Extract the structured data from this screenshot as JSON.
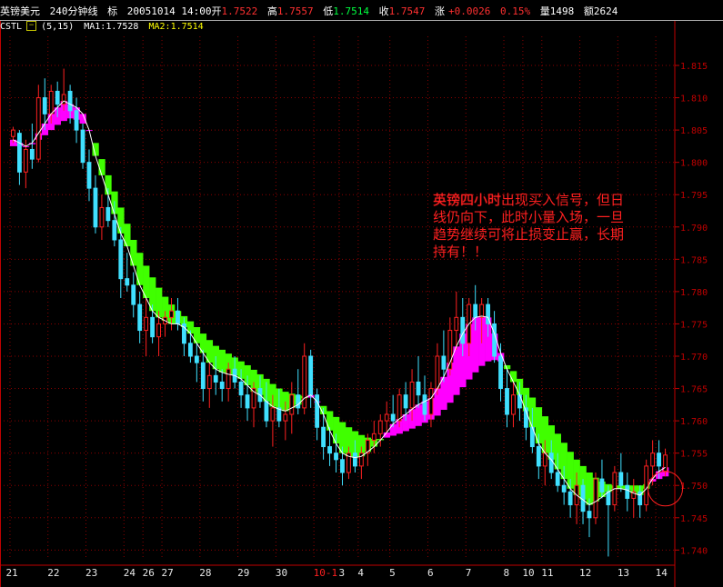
{
  "header": {
    "symbol": "英镑美元",
    "period": "240分钟线",
    "mark": "标",
    "datetime": "20051014 14:00",
    "open_label": "开",
    "open": "1.7522",
    "high_label": "高",
    "high": "1.7557",
    "low_label": "低",
    "low": "1.7514",
    "close_label": "收",
    "close": "1.7547",
    "change_label": "涨",
    "change": "+0.0026",
    "change_pct": "0.15%",
    "volume_label": "量",
    "volume": "1498",
    "amount_label": "额",
    "amount": "2624"
  },
  "indicator": {
    "name": "CSTL",
    "toggle": "−",
    "params": "(5,15)",
    "ma1": "MA1:1.7528",
    "ma2": "MA2:1.7514"
  },
  "annotation": {
    "lead": "英镑四小时",
    "rest": "出现买入信号，但日线仍向下，此时小量入场，一旦趋势继续可将止损变止赢，长期持有！！"
  },
  "colors": {
    "bull": "#ff2020",
    "bear": "#40e0ff",
    "fill_up": "#ff00ff",
    "fill_down": "#40ff00",
    "ma_line": "#ffffff",
    "grid": "#8b0000",
    "axis": "#c00000"
  },
  "chart_data": {
    "type": "candlestick",
    "title": "",
    "ylim": [
      1.7385,
      1.8195
    ],
    "y_ticks": [
      "1.815",
      "1.810",
      "1.805",
      "1.800",
      "1.795",
      "1.790",
      "1.785",
      "1.780",
      "1.775",
      "1.770",
      "1.765",
      "1.760",
      "1.755",
      "1.750",
      "1.745",
      "1.740"
    ],
    "x_labels": [
      {
        "label": "21",
        "i": 0
      },
      {
        "label": "22",
        "i": 6
      },
      {
        "label": "23",
        "i": 12
      },
      {
        "label": "24",
        "i": 18
      },
      {
        "label": "26",
        "i": 21
      },
      {
        "label": "27",
        "i": 24
      },
      {
        "label": "28",
        "i": 30
      },
      {
        "label": "29",
        "i": 36
      },
      {
        "label": "30",
        "i": 42
      },
      {
        "label": "10-1",
        "i": 48
      },
      {
        "label": "3",
        "i": 52
      },
      {
        "label": "4",
        "i": 55
      },
      {
        "label": "5",
        "i": 60
      },
      {
        "label": "6",
        "i": 66
      },
      {
        "label": "7",
        "i": 72
      },
      {
        "label": "8",
        "i": 78
      },
      {
        "label": "10",
        "i": 81
      },
      {
        "label": "11",
        "i": 84
      },
      {
        "label": "12",
        "i": 90
      },
      {
        "label": "13",
        "i": 96
      },
      {
        "label": "14",
        "i": 102
      }
    ],
    "candles": [
      [
        1.804,
        1.8055,
        1.803,
        1.805
      ],
      [
        1.8045,
        1.805,
        1.7965,
        1.7985
      ],
      [
        1.7985,
        1.8035,
        1.796,
        1.802
      ],
      [
        1.802,
        1.806,
        1.799,
        1.8005
      ],
      [
        1.8005,
        1.812,
        1.8,
        1.81
      ],
      [
        1.81,
        1.813,
        1.805,
        1.8075
      ],
      [
        1.8075,
        1.812,
        1.806,
        1.811
      ],
      [
        1.811,
        1.8125,
        1.807,
        1.809
      ],
      [
        1.809,
        1.8145,
        1.808,
        1.8105
      ],
      [
        1.811,
        1.812,
        1.806,
        1.808
      ],
      [
        1.808,
        1.81,
        1.803,
        1.805
      ],
      [
        1.805,
        1.806,
        1.799,
        1.8
      ],
      [
        1.8,
        1.802,
        1.794,
        1.796
      ],
      [
        1.796,
        1.798,
        1.789,
        1.79
      ],
      [
        1.79,
        1.795,
        1.788,
        1.793
      ],
      [
        1.793,
        1.796,
        1.79,
        1.791
      ],
      [
        1.791,
        1.794,
        1.787,
        1.788
      ],
      [
        1.788,
        1.79,
        1.779,
        1.782
      ],
      [
        1.782,
        1.786,
        1.78,
        1.781
      ],
      [
        1.781,
        1.783,
        1.776,
        1.778
      ],
      [
        1.778,
        1.78,
        1.772,
        1.774
      ],
      [
        1.774,
        1.779,
        1.77,
        1.776
      ],
      [
        1.776,
        1.778,
        1.772,
        1.773
      ],
      [
        1.773,
        1.777,
        1.77,
        1.775
      ],
      [
        1.775,
        1.777,
        1.773,
        1.776
      ],
      [
        1.776,
        1.779,
        1.774,
        1.777
      ],
      [
        1.777,
        1.779,
        1.774,
        1.775
      ],
      [
        1.775,
        1.776,
        1.77,
        1.772
      ],
      [
        1.772,
        1.774,
        1.769,
        1.77
      ],
      [
        1.77,
        1.772,
        1.766,
        1.769
      ],
      [
        1.769,
        1.771,
        1.763,
        1.765
      ],
      [
        1.765,
        1.769,
        1.762,
        1.767
      ],
      [
        1.767,
        1.77,
        1.764,
        1.766
      ],
      [
        1.766,
        1.768,
        1.763,
        1.765
      ],
      [
        1.765,
        1.769,
        1.763,
        1.768
      ],
      [
        1.768,
        1.77,
        1.765,
        1.766
      ],
      [
        1.766,
        1.768,
        1.762,
        1.764
      ],
      [
        1.764,
        1.767,
        1.76,
        1.762
      ],
      [
        1.762,
        1.766,
        1.759,
        1.765
      ],
      [
        1.765,
        1.767,
        1.762,
        1.763
      ],
      [
        1.763,
        1.766,
        1.759,
        1.76
      ],
      [
        1.76,
        1.764,
        1.756,
        1.762
      ],
      [
        1.762,
        1.765,
        1.759,
        1.76
      ],
      [
        1.76,
        1.763,
        1.757,
        1.761
      ],
      [
        1.761,
        1.766,
        1.758,
        1.764
      ],
      [
        1.764,
        1.768,
        1.761,
        1.762
      ],
      [
        1.762,
        1.772,
        1.761,
        1.77
      ],
      [
        1.77,
        1.771,
        1.762,
        1.764
      ],
      [
        1.764,
        1.765,
        1.757,
        1.759
      ],
      [
        1.759,
        1.762,
        1.754,
        1.756
      ],
      [
        1.756,
        1.759,
        1.753,
        1.755
      ],
      [
        1.755,
        1.758,
        1.752,
        1.754
      ],
      [
        1.754,
        1.756,
        1.75,
        1.752
      ],
      [
        1.752,
        1.756,
        1.751,
        1.755
      ],
      [
        1.755,
        1.757,
        1.752,
        1.753
      ],
      [
        1.753,
        1.756,
        1.751,
        1.755
      ],
      [
        1.755,
        1.758,
        1.753,
        1.757
      ],
      [
        1.757,
        1.76,
        1.755,
        1.758
      ],
      [
        1.758,
        1.761,
        1.756,
        1.76
      ],
      [
        1.76,
        1.763,
        1.758,
        1.761
      ],
      [
        1.761,
        1.764,
        1.759,
        1.76
      ],
      [
        1.76,
        1.765,
        1.759,
        1.764
      ],
      [
        1.764,
        1.766,
        1.76,
        1.762
      ],
      [
        1.762,
        1.768,
        1.76,
        1.766
      ],
      [
        1.766,
        1.77,
        1.762,
        1.764
      ],
      [
        1.764,
        1.767,
        1.76,
        1.761
      ],
      [
        1.761,
        1.766,
        1.759,
        1.765
      ],
      [
        1.765,
        1.772,
        1.764,
        1.77
      ],
      [
        1.77,
        1.774,
        1.766,
        1.768
      ],
      [
        1.768,
        1.776,
        1.767,
        1.774
      ],
      [
        1.774,
        1.78,
        1.771,
        1.776
      ],
      [
        1.776,
        1.779,
        1.77,
        1.772
      ],
      [
        1.772,
        1.779,
        1.77,
        1.778
      ],
      [
        1.778,
        1.781,
        1.774,
        1.776
      ],
      [
        1.776,
        1.779,
        1.772,
        1.778
      ],
      [
        1.778,
        1.779,
        1.773,
        1.775
      ],
      [
        1.775,
        1.777,
        1.769,
        1.77
      ],
      [
        1.77,
        1.772,
        1.763,
        1.765
      ],
      [
        1.765,
        1.768,
        1.759,
        1.761
      ],
      [
        1.761,
        1.766,
        1.759,
        1.764
      ],
      [
        1.764,
        1.766,
        1.76,
        1.762
      ],
      [
        1.762,
        1.764,
        1.757,
        1.759
      ],
      [
        1.759,
        1.762,
        1.755,
        1.756
      ],
      [
        1.756,
        1.758,
        1.751,
        1.753
      ],
      [
        1.753,
        1.757,
        1.75,
        1.755
      ],
      [
        1.755,
        1.757,
        1.751,
        1.752
      ],
      [
        1.752,
        1.755,
        1.749,
        1.75
      ],
      [
        1.75,
        1.753,
        1.747,
        1.749
      ],
      [
        1.749,
        1.751,
        1.745,
        1.747
      ],
      [
        1.747,
        1.752,
        1.744,
        1.75
      ],
      [
        1.75,
        1.751,
        1.744,
        1.746
      ],
      [
        1.746,
        1.748,
        1.742,
        1.745
      ],
      [
        1.745,
        1.752,
        1.744,
        1.751
      ],
      [
        1.751,
        1.754,
        1.748,
        1.749
      ],
      [
        1.749,
        1.75,
        1.739,
        1.747
      ],
      [
        1.747,
        1.753,
        1.746,
        1.752
      ],
      [
        1.752,
        1.755,
        1.749,
        1.75
      ],
      [
        1.75,
        1.752,
        1.746,
        1.748
      ],
      [
        1.748,
        1.751,
        1.745,
        1.749
      ],
      [
        1.749,
        1.75,
        1.745,
        1.747
      ],
      [
        1.747,
        1.754,
        1.746,
        1.753
      ],
      [
        1.753,
        1.757,
        1.75,
        1.755
      ],
      [
        1.755,
        1.757,
        1.751,
        1.753
      ],
      [
        1.7522,
        1.7557,
        1.7514,
        1.7547
      ]
    ],
    "ma1": [
      1.8035,
      1.803,
      1.8025,
      1.803,
      1.8045,
      1.806,
      1.8075,
      1.8085,
      1.8095,
      1.809,
      1.8085,
      1.8075,
      1.805,
      1.801,
      1.798,
      1.795,
      1.792,
      1.789,
      1.787,
      1.784,
      1.781,
      1.779,
      1.777,
      1.776,
      1.7755,
      1.775,
      1.775,
      1.7745,
      1.7735,
      1.772,
      1.7705,
      1.769,
      1.768,
      1.7675,
      1.7672,
      1.767,
      1.7665,
      1.7655,
      1.7645,
      1.764,
      1.763,
      1.7622,
      1.7618,
      1.7615,
      1.762,
      1.7625,
      1.7635,
      1.764,
      1.763,
      1.761,
      1.7585,
      1.7565,
      1.755,
      1.7545,
      1.7543,
      1.7545,
      1.7552,
      1.756,
      1.757,
      1.7582,
      1.7595,
      1.7603,
      1.761,
      1.7618,
      1.7625,
      1.763,
      1.7635,
      1.765,
      1.7668,
      1.769,
      1.7715,
      1.7735,
      1.775,
      1.776,
      1.7762,
      1.776,
      1.7735,
      1.7705,
      1.768,
      1.766,
      1.764,
      1.7615,
      1.759,
      1.7565,
      1.755,
      1.754,
      1.7525,
      1.751,
      1.7495,
      1.7485,
      1.7478,
      1.747,
      1.7475,
      1.7482,
      1.749,
      1.7495,
      1.7495,
      1.7493,
      1.7488,
      1.7485,
      1.7495,
      1.751,
      1.7522,
      1.7528
    ],
    "ma2": [
      1.8025,
      1.8025,
      1.8025,
      1.8028,
      1.8035,
      1.8042,
      1.805,
      1.8058,
      1.8064,
      1.8068,
      1.8066,
      1.806,
      1.805,
      1.803,
      1.8005,
      1.798,
      1.7955,
      1.793,
      1.7905,
      1.788,
      1.786,
      1.784,
      1.7822,
      1.7806,
      1.7792,
      1.778,
      1.777,
      1.7762,
      1.7754,
      1.7745,
      1.7735,
      1.7725,
      1.7716,
      1.771,
      1.7704,
      1.7698,
      1.7692,
      1.7686,
      1.7679,
      1.7672,
      1.7665,
      1.7657,
      1.765,
      1.7645,
      1.7642,
      1.764,
      1.7638,
      1.7636,
      1.763,
      1.7623,
      1.7615,
      1.7606,
      1.7598,
      1.759,
      1.7584,
      1.7578,
      1.7574,
      1.7572,
      1.7572,
      1.7574,
      1.7577,
      1.758,
      1.7584,
      1.7588,
      1.7592,
      1.7597,
      1.7602,
      1.7608,
      1.7617,
      1.7628,
      1.764,
      1.7652,
      1.7664,
      1.7675,
      1.7685,
      1.7692,
      1.7694,
      1.7692,
      1.7686,
      1.7677,
      1.7665,
      1.7651,
      1.7636,
      1.7621,
      1.7607,
      1.7593,
      1.758,
      1.7566,
      1.7552,
      1.754,
      1.753,
      1.752,
      1.7512,
      1.7506,
      1.7502,
      1.75,
      1.75,
      1.75,
      1.75,
      1.75,
      1.7502,
      1.7506,
      1.751,
      1.7514
    ],
    "highlight_circle": {
      "i": 103,
      "y": 1.7495
    }
  }
}
